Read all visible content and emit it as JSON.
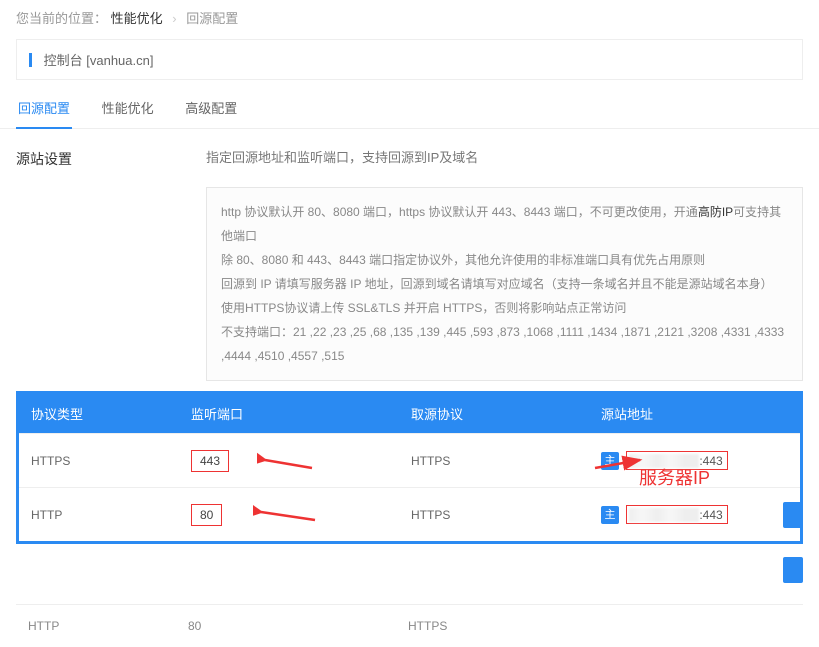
{
  "breadcrumb": {
    "label": "您当前的位置：",
    "a": "性能优化",
    "b": "回源配置"
  },
  "console": {
    "prefix": "控制台 ",
    "domain": "[vanhua.cn]"
  },
  "tabs": {
    "t1": "回源配置",
    "t2": "性能优化",
    "t3": "高级配置"
  },
  "section": {
    "title": "源站设置",
    "desc": "指定回源地址和监听端口，支持回源到IP及域名"
  },
  "info": {
    "l1a": "http 协议默认开 80、8080 端口，https 协议默认开 443、8443 端口，不可更改使用，开通",
    "l1hl": "高防IP",
    "l1b": "可支持其他端口",
    "l2": "除 80、8080 和 443、8443 端口指定协议外，其他允许使用的非标准端口具有优先占用原则",
    "l3": "回源到 IP 请填写服务器 IP 地址，回源到域名请填写对应域名（支持一条域名并且不能是源站域名本身）",
    "l4": "使用HTTPS协议请上传 SSL&TLS 并开启 HTTPS，否则将影响站点正常访问",
    "l5": "不支持端口：21 ,22 ,23 ,25 ,68 ,135 ,139 ,445 ,593 ,873 ,1068 ,1111 ,1434 ,1871 ,2121 ,3208 ,4331 ,4333 ,4444 ,4510 ,4557 ,515"
  },
  "thead": {
    "c1": "协议类型",
    "c2": "监听端口",
    "c3": "取源协议",
    "c4": "源站地址"
  },
  "rows": [
    {
      "proto": "HTTPS",
      "port": "443",
      "srcproto": "HTTPS",
      "srcport": ":443"
    },
    {
      "proto": "HTTP",
      "port": "80",
      "srcproto": "HTTPS",
      "srcport": ":443"
    }
  ],
  "tag_main": "主",
  "serverip_label": "服务器IP",
  "lower": {
    "proto": "HTTP",
    "port": "80",
    "srcproto": "HTTPS"
  }
}
